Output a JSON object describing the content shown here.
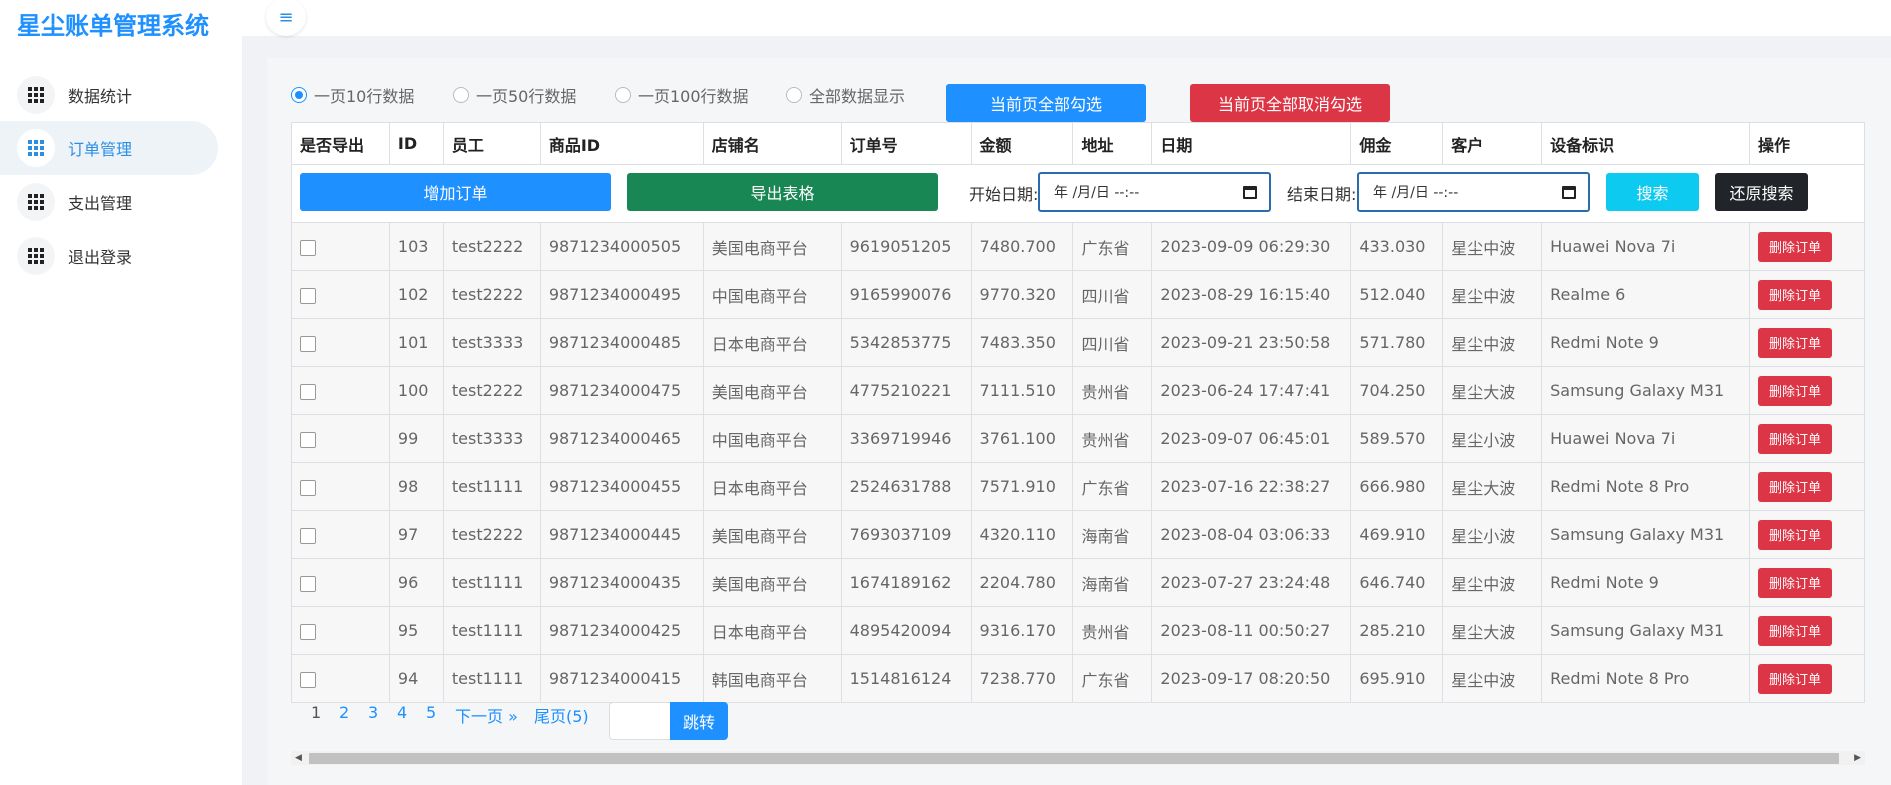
{
  "app": {
    "title": "星尘账单管理系统"
  },
  "sidebar": {
    "items": [
      {
        "label": "数据统计",
        "icon": "grid-icon",
        "active": false
      },
      {
        "label": "订单管理",
        "icon": "grid-icon",
        "active": true
      },
      {
        "label": "支出管理",
        "icon": "grid-icon",
        "active": false
      },
      {
        "label": "退出登录",
        "icon": "grid-icon",
        "active": false
      }
    ]
  },
  "header": {
    "menu_icon": "≡"
  },
  "page_size": {
    "options": [
      "一页10行数据",
      "一页50行数据",
      "一页100行数据",
      "全部数据显示"
    ],
    "selected": "一页10行数据"
  },
  "actions": {
    "select_all": "当前页全部勾选",
    "deselect_all": "当前页全部取消勾选"
  },
  "table": {
    "headers": [
      "是否导出",
      "ID",
      "员工",
      "商品ID",
      "店铺名",
      "订单号",
      "金额",
      "地址",
      "日期",
      "佣金",
      "客户",
      "设备标识",
      "操作"
    ],
    "rows": [
      [
        "103",
        "test2222",
        "9871234000505",
        "美国电商平台",
        "9619051205",
        "7480.700",
        "广东省",
        "2023-09-09 06:29:30",
        "433.030",
        "星尘中波",
        "Huawei Nova 7i"
      ],
      [
        "102",
        "test2222",
        "9871234000495",
        "中国电商平台",
        "9165990076",
        "9770.320",
        "四川省",
        "2023-08-29 16:15:40",
        "512.040",
        "星尘中波",
        "Realme 6"
      ],
      [
        "101",
        "test3333",
        "9871234000485",
        "日本电商平台",
        "5342853775",
        "7483.350",
        "四川省",
        "2023-09-21 23:50:58",
        "571.780",
        "星尘中波",
        "Redmi Note 9"
      ],
      [
        "100",
        "test2222",
        "9871234000475",
        "美国电商平台",
        "4775210221",
        "7111.510",
        "贵州省",
        "2023-06-24 17:47:41",
        "704.250",
        "星尘大波",
        "Samsung Galaxy M31"
      ],
      [
        "99",
        "test3333",
        "9871234000465",
        "中国电商平台",
        "3369719946",
        "3761.100",
        "贵州省",
        "2023-09-07 06:45:01",
        "589.570",
        "星尘小波",
        "Huawei Nova 7i"
      ],
      [
        "98",
        "test1111",
        "9871234000455",
        "日本电商平台",
        "2524631788",
        "7571.910",
        "广东省",
        "2023-07-16 22:38:27",
        "666.980",
        "星尘大波",
        "Redmi Note 8 Pro"
      ],
      [
        "97",
        "test2222",
        "9871234000445",
        "美国电商平台",
        "7693037109",
        "4320.110",
        "海南省",
        "2023-08-04 03:06:33",
        "469.910",
        "星尘小波",
        "Samsung Galaxy M31"
      ],
      [
        "96",
        "test1111",
        "9871234000435",
        "美国电商平台",
        "1674189162",
        "2204.780",
        "海南省",
        "2023-07-27 23:24:48",
        "646.740",
        "星尘中波",
        "Redmi Note 9"
      ],
      [
        "95",
        "test1111",
        "9871234000425",
        "日本电商平台",
        "4895420094",
        "9316.170",
        "贵州省",
        "2023-08-11 00:50:27",
        "285.210",
        "星尘大波",
        "Samsung Galaxy M31"
      ],
      [
        "94",
        "test1111",
        "9871234000415",
        "韩国电商平台",
        "1514816124",
        "7238.770",
        "广东省",
        "2023-09-17 08:20:50",
        "695.910",
        "星尘中波",
        "Redmi Note 8 Pro"
      ]
    ],
    "delete_label": "删除订单"
  },
  "toolbar": {
    "add_order": "增加订单",
    "export": "导出表格",
    "start_label": "开始日期:",
    "end_label": "结束日期:",
    "date_placeholder": "年 /月/日 --:--",
    "search": "搜索",
    "reset": "还原搜索"
  },
  "pagination": {
    "pages": [
      "1",
      "2",
      "3",
      "4",
      "5"
    ],
    "next": "下一页 »",
    "last": "尾页(5)",
    "jump": "跳转"
  },
  "colors": {
    "primary": "#1e90ff",
    "success": "#198754",
    "danger": "#dc3545",
    "info": "#0dcaf0",
    "dark": "#212529"
  }
}
